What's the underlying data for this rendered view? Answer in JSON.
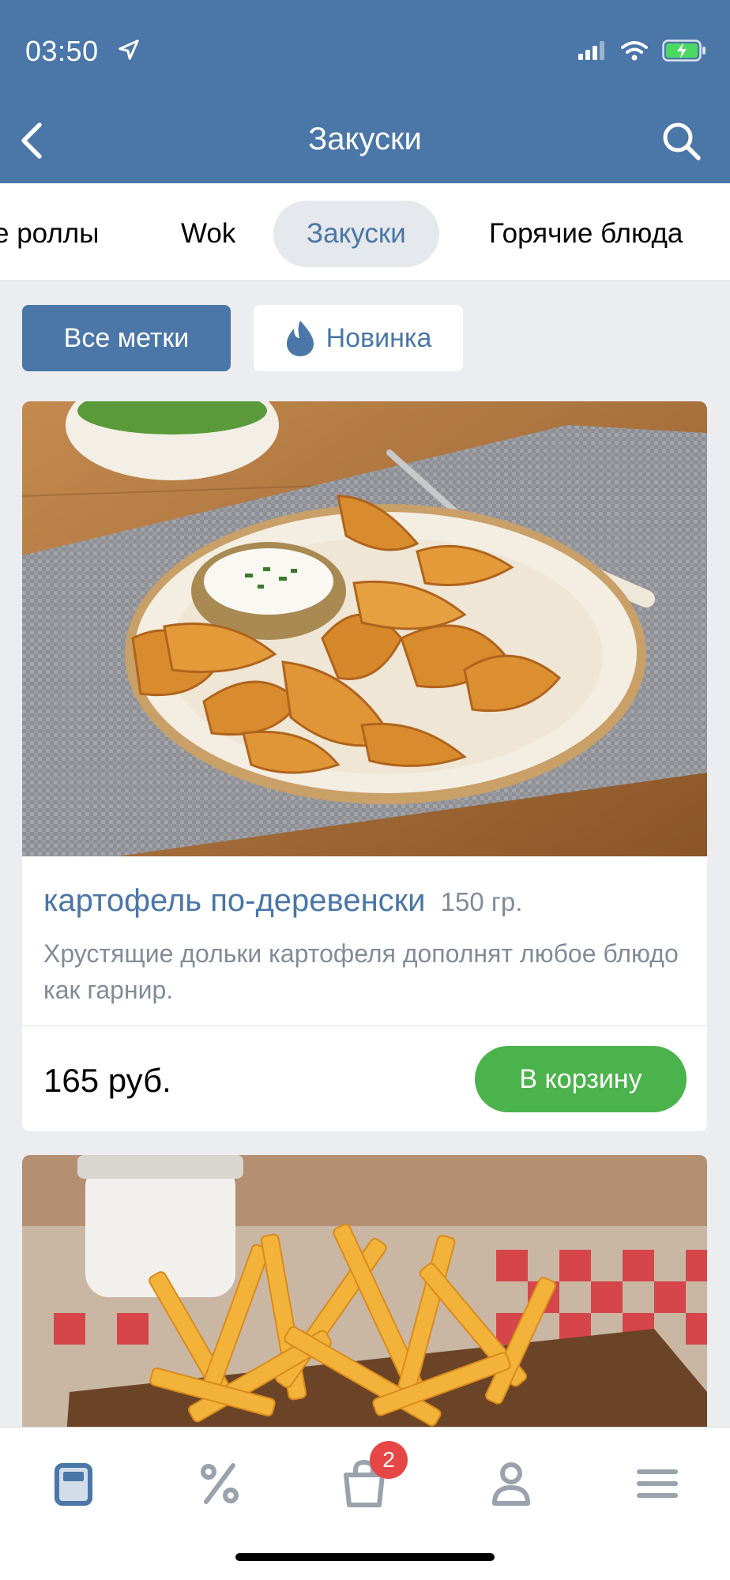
{
  "status_bar": {
    "time": "03:50",
    "icons": [
      "location-arrow-icon",
      "cellular-signal-icon",
      "wifi-icon",
      "battery-charging-icon"
    ]
  },
  "nav": {
    "title": "Закуски",
    "back_icon": "chevron-left-icon",
    "search_icon": "search-icon"
  },
  "tabs": [
    {
      "label": "е роллы"
    },
    {
      "label": "Wok"
    },
    {
      "label": "Закуски",
      "active": true
    },
    {
      "label": "Горячие блюда"
    }
  ],
  "filters": {
    "all": "Все метки",
    "new": "Новинка",
    "new_icon": "drop-icon"
  },
  "products": [
    {
      "name": "картофель по-деревенски",
      "weight": "150 гр.",
      "description": "Хрустящие дольки картофеля дополнят любое блюдо как гарнир.",
      "price": "165 руб.",
      "cart_label": "В корзину"
    }
  ],
  "bottom_bar": {
    "items": [
      "menu-card-icon",
      "percent-icon",
      "shopping-bag-icon",
      "profile-icon",
      "hamburger-icon"
    ],
    "cart_badge": "2"
  },
  "colors": {
    "brand": "#4a76a8",
    "accent_green": "#4bb34b",
    "badge_red": "#e64646",
    "muted": "#818c99"
  }
}
